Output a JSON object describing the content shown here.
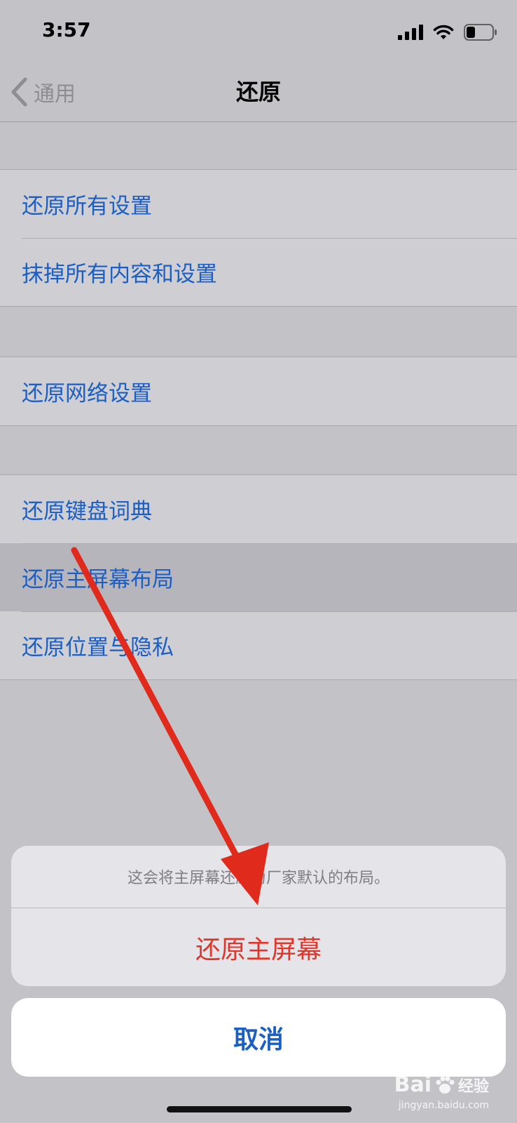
{
  "status_bar": {
    "time": "3:57"
  },
  "nav": {
    "back_label": "通用",
    "title": "还原"
  },
  "groups": [
    {
      "items": [
        {
          "label": "还原所有设置"
        },
        {
          "label": "抹掉所有内容和设置"
        }
      ]
    },
    {
      "items": [
        {
          "label": "还原网络设置"
        }
      ]
    },
    {
      "items": [
        {
          "label": "还原键盘词典"
        },
        {
          "label": "还原主屏幕布局"
        },
        {
          "label": "还原位置与隐私"
        }
      ]
    }
  ],
  "action_sheet": {
    "message": "这会将主屏幕还原为厂家默认的布局。",
    "action_label": "还原主屏幕",
    "cancel_label": "取消"
  },
  "watermark": {
    "brand": "Bai",
    "suffix": "经验",
    "url": "jingyan.baidu.com"
  },
  "colors": {
    "link_blue": "#1b5fc4",
    "destructive_red": "#e1352a",
    "arrow_red": "#e02a1c"
  }
}
